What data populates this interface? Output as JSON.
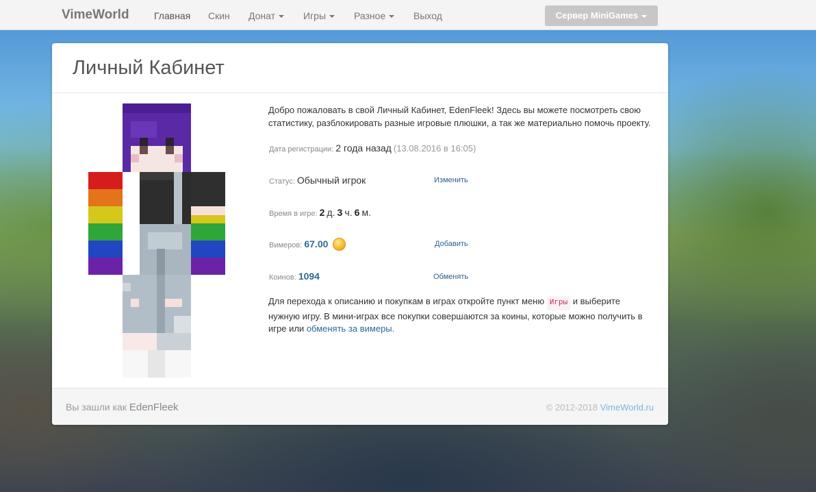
{
  "navbar": {
    "brand": "VimeWorld",
    "items": [
      {
        "label": "Главная",
        "active": true,
        "dropdown": false
      },
      {
        "label": "Скин",
        "active": false,
        "dropdown": false
      },
      {
        "label": "Донат",
        "active": false,
        "dropdown": true
      },
      {
        "label": "Игры",
        "active": false,
        "dropdown": true
      },
      {
        "label": "Разное",
        "active": false,
        "dropdown": true
      },
      {
        "label": "Выход",
        "active": false,
        "dropdown": false
      }
    ],
    "server_button": "Сервер MiniGames"
  },
  "panel": {
    "title": "Личный Кабинет",
    "intro": "Добро пожаловать в свой Личный Кабинет, EdenFleek! Здесь вы можете посмотреть свою статистику, разблокировать разные игровые плюшки, а так же материально помочь проекту.",
    "registration": {
      "label": "Дата регистрации:",
      "value": "2 года назад",
      "exact": "(13.08.2016 в 16:05)"
    },
    "status": {
      "label": "Статус:",
      "value": "Обычный игрок",
      "action": "Изменить"
    },
    "playtime": {
      "label": "Время в игре:",
      "days": "2",
      "days_unit": "д.",
      "hours": "3",
      "hours_unit": "ч.",
      "minutes": "6",
      "minutes_unit": "м."
    },
    "vimers": {
      "label": "Вимеров:",
      "value": "67.00",
      "icon": "gold-coin-icon",
      "action": "Добавить"
    },
    "coins": {
      "label": "Коинов:",
      "value": "1094",
      "action": "Обменять"
    },
    "bottom_text": {
      "part1": "Для перехода к описанию и покупкам в играх откройте пункт меню",
      "code": "Игры",
      "part2": "и выберите нужную игру. В мини-играх все покупки совершаются за коины, которые можно получить в игре или",
      "link": "обменять за вимеры."
    }
  },
  "footer": {
    "logged_prefix": "Вы зашли как",
    "username": "EdenFleek",
    "copyright": "© 2012-2018",
    "site": "VimeWorld.ru"
  },
  "colors": {
    "accent": "#2c6a96",
    "server_button": "#c7c7c7",
    "code_text": "#c7254e"
  }
}
